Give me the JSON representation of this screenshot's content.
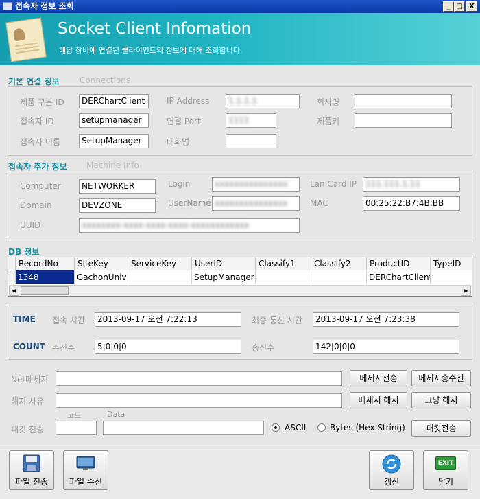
{
  "window": {
    "title": "접속자 정보 조회",
    "min": "_",
    "max": "□",
    "close": "X"
  },
  "banner": {
    "title": "Socket Client Infomation",
    "subtitle": "해당 장비에 연결된 클라이언트의 정보에 대해 조회합니다."
  },
  "connections": {
    "header": "기본 연결 정보",
    "header_en": "Connections",
    "product_id_label": "제품 구분 ID",
    "product_id": "DERChartClient",
    "user_id_label": "접속자 ID",
    "user_id": "setupmanager",
    "user_name_label": "접속자 이름",
    "user_name": "SetupManager",
    "ip_label": "IP Address",
    "ip": "1.1.1.1",
    "port_label": "연결 Port",
    "port": "1111",
    "chat_label": "대화명",
    "chat": "",
    "company_label": "회사명",
    "company": "",
    "product_key_label": "제품키",
    "product_key": ""
  },
  "machine": {
    "header": "접속자 추가 정보",
    "header_en": "Machine Info",
    "computer_label": "Computer",
    "computer": "NETWORKER",
    "domain_label": "Domain",
    "domain": "DEVZONE",
    "uuid_label": "UUID",
    "uuid": "xxxxxxxx-xxxx-xxxx-xxxx-xxxxxxxxxxxx",
    "login_label": "Login",
    "login": "xxxxxxxxxxxxxxx",
    "username_label": "UserName",
    "username": "xxxxxxxxxxxxxxx",
    "lancard_label": "Lan Card IP",
    "lancard": "111.111.1.11",
    "mac_label": "MAC",
    "mac": "00:25:22:B7:4B:BB"
  },
  "db": {
    "header": "DB 정보",
    "columns": [
      "RecordNo",
      "SiteKey",
      "ServiceKey",
      "UserID",
      "Classify1",
      "Classify2",
      "ProductID",
      "TypeID"
    ],
    "row": [
      "1348",
      "GachonUniv",
      "",
      "SetupManager",
      "",
      "",
      "DERChartClient",
      ""
    ]
  },
  "status": {
    "time_label": "TIME",
    "connect_time_label": "접속 시간",
    "connect_time": "2013-09-17 오전 7:22:13",
    "last_comm_label": "최종 통신 시간",
    "last_comm": "2013-09-17 오전 7:23:38",
    "count_label": "COUNT",
    "recv_label": "수신수",
    "recv": "5|0|0|0",
    "send_label": "송신수",
    "send": "142|0|0|0"
  },
  "actions": {
    "net_msg_label": "Net메세지",
    "send_msg_btn": "메세지전송",
    "send_recv_btn": "메세지송수신",
    "release_reason_label": "해지 사유",
    "release_msg_btn": "메세지 해지",
    "just_release_btn": "그냥 해지",
    "packet_label": "패킷 전송",
    "code_label": "코드",
    "data_label": "Data",
    "ascii_label": "ASCII",
    "bytes_label": "Bytes (Hex String)",
    "packet_send_btn": "패킷전송"
  },
  "footer": {
    "file_send": "파일 전송",
    "file_recv": "파일 수신",
    "refresh": "갱신",
    "close": "닫기",
    "exit_badge": "EXIT"
  }
}
